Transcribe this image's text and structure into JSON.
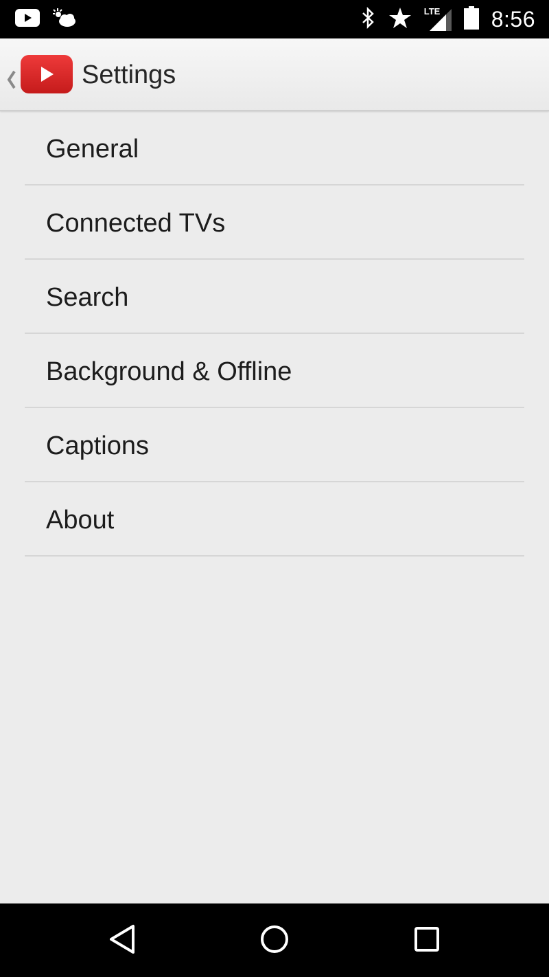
{
  "status_bar": {
    "time": "8:56",
    "network_label": "LTE",
    "icons": [
      "youtube-notification-icon",
      "weather-icon",
      "bluetooth-icon",
      "star-icon",
      "signal-icon",
      "battery-icon"
    ]
  },
  "action_bar": {
    "title": "Settings",
    "logo_color": "#e22626"
  },
  "settings": {
    "items": [
      {
        "label": "General"
      },
      {
        "label": "Connected TVs"
      },
      {
        "label": "Search"
      },
      {
        "label": "Background & Offline"
      },
      {
        "label": "Captions"
      },
      {
        "label": "About"
      }
    ]
  },
  "nav_bar": {
    "buttons": [
      "back-icon",
      "home-icon",
      "recents-icon"
    ]
  }
}
